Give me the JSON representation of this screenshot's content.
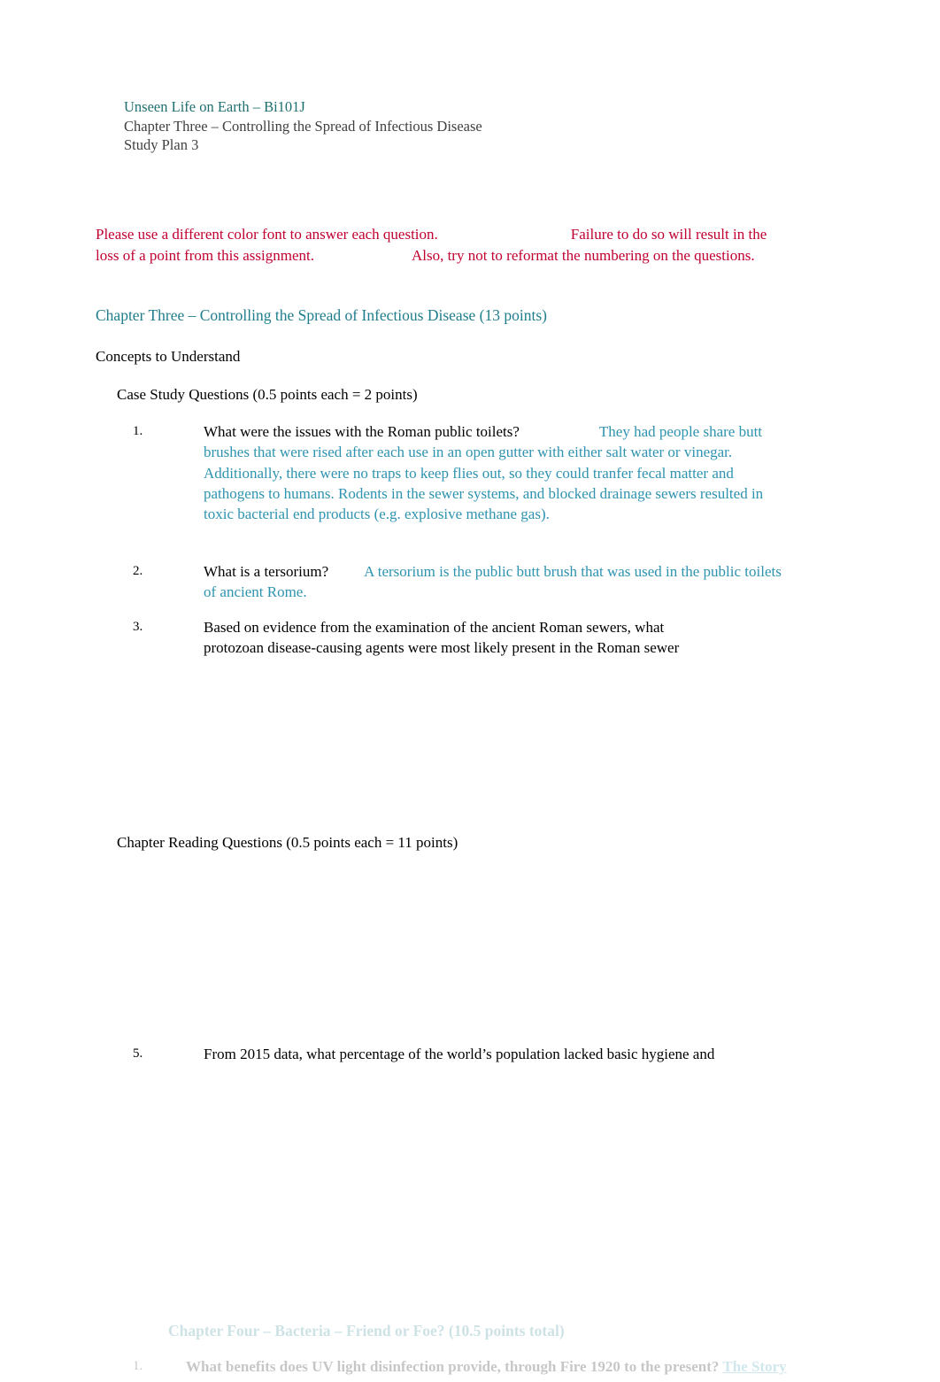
{
  "document": {
    "header": {
      "course": "Unseen Life on Earth – Bi101J",
      "chapter": "Chapter Three – Controlling the Spread of Infectious Disease",
      "study_plan": "Study Plan 3"
    },
    "instructions": {
      "part1": "Please use a different color font to answer each question.",
      "part2": "Failure to do so will",
      "part3": "result in the loss of a point from this assignment.",
      "part4": "Also, try not to reformat the",
      "part5": "numbering on the questions."
    },
    "chapter_heading": "Chapter Three – Controlling the Spread of Infectious Disease (13 points)",
    "concepts_heading": "Concepts to Understand",
    "case_study_heading": "Case Study Questions (0.5 points each = 2 points)",
    "reading_heading": "Chapter Reading Questions (0.5 points each = 11 points)",
    "questions": [
      {
        "number": "1.",
        "text": "What were the issues with the Roman public toilets?",
        "answer": "They had people share butt brushes that were rised after each use in an open gutter with either salt water or vinegar. Additionally, there were no traps to keep flies out, so they could tranfer fecal matter and pathogens to humans. Rodents in the sewer systems, and blocked drainage sewers resulted in toxic bacterial end products (e.g. explosive methane gas)."
      },
      {
        "number": "2.",
        "text": "What is a tersorium?",
        "answer": "A tersorium is the public butt brush that was used in the public toilets of ancient Rome."
      },
      {
        "number": "3.",
        "text": "Based on evidence from the examination of the ancient Roman sewers, what protozoan disease-causing agents were most likely present in the Roman sewer",
        "answer": ""
      },
      {
        "number": "5.",
        "text": "From 2015 data, what percentage of the world’s population lacked basic hygiene and",
        "answer": ""
      }
    ],
    "faded": {
      "heading": "Chapter Four – Bacteria – Friend or Foe? (10.5 points total)",
      "number": "1.",
      "text": "What benefits does UV light disinfection provide, through Fire 1920 to the present?",
      "link": "The Story"
    }
  }
}
